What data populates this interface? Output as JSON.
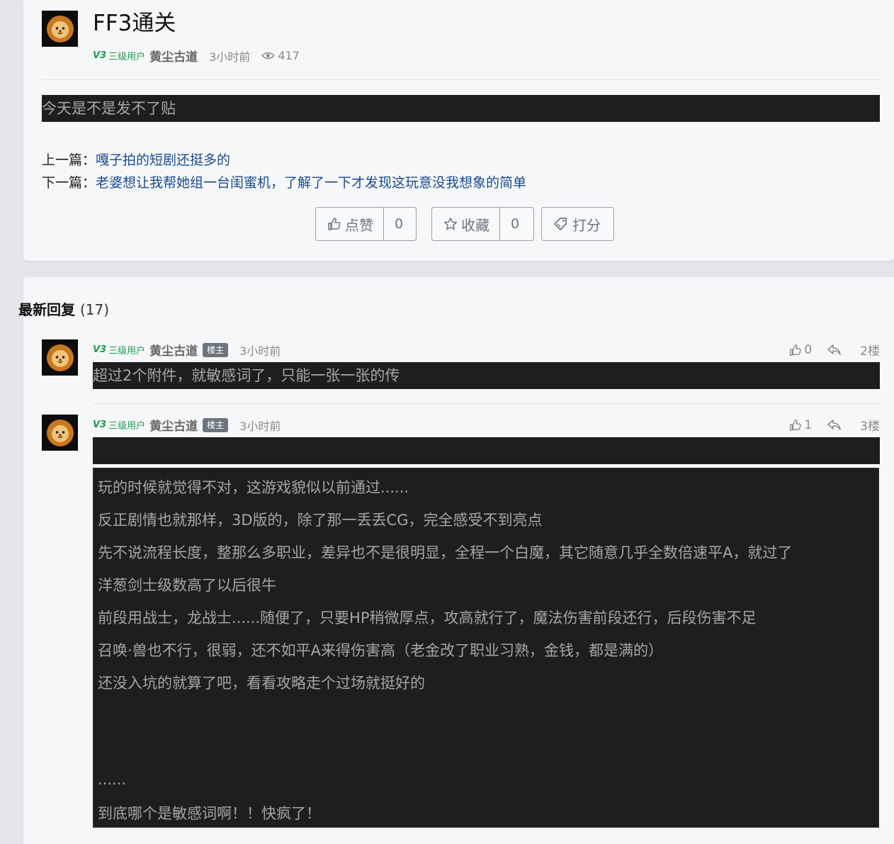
{
  "post": {
    "title": "FF3通关",
    "author": {
      "level_icon": "V3",
      "level": "三级用户",
      "name": "黄尘古道"
    },
    "time": "3小时前",
    "views": "417",
    "content": "今天是不是发不了贴",
    "prev": {
      "prefix": "上一篇：",
      "title": "嘎子拍的短剧还挺多的"
    },
    "next": {
      "prefix": "下一篇：",
      "title": "老婆想让我帮她组一台闺蜜机，了解了一下才发现这玩意没我想象的简单"
    },
    "buttons": {
      "like_label": "点赞",
      "like_count": "0",
      "fav_label": "收藏",
      "fav_count": "0",
      "rate_label": "打分"
    }
  },
  "replies": {
    "title": "最新回复",
    "count": "(17)",
    "items": [
      {
        "level_icon": "V3",
        "level": "三级用户",
        "name": "黄尘古道",
        "badge": "楼主",
        "time": "3小时前",
        "likes": "0",
        "floor": "2楼",
        "content": "超过2个附件，就敏感词了，只能一张一张的传"
      },
      {
        "level_icon": "V3",
        "level": "三级用户",
        "name": "黄尘古道",
        "badge": "楼主",
        "time": "3小时前",
        "likes": "1",
        "floor": "3楼",
        "content": "",
        "quote_lines": [
          "玩的时候就觉得不对，这游戏貌似以前通过......",
          "反正剧情也就那样，3D版的，除了那一丢丢CG，完全感受不到亮点",
          "先不说流程长度，整那么多职业，差异也不是很明显，全程一个白魔，其它随意几乎全数倍速平A，就过了",
          "洋葱剑士级数高了以后很牛",
          "前段用战士，龙战士......随便了，只要HP稍微厚点，攻高就行了，魔法伤害前段还行，后段伤害不足",
          "召唤·兽也不行，很弱，还不如平A来得伤害高（老金改了职业习熟，金钱，都是满的）",
          "还没入坑的就算了吧，看看攻略走个过场就挺好的",
          "......",
          "到底哪个是敏感词啊！！快疯了！"
        ]
      }
    ]
  }
}
